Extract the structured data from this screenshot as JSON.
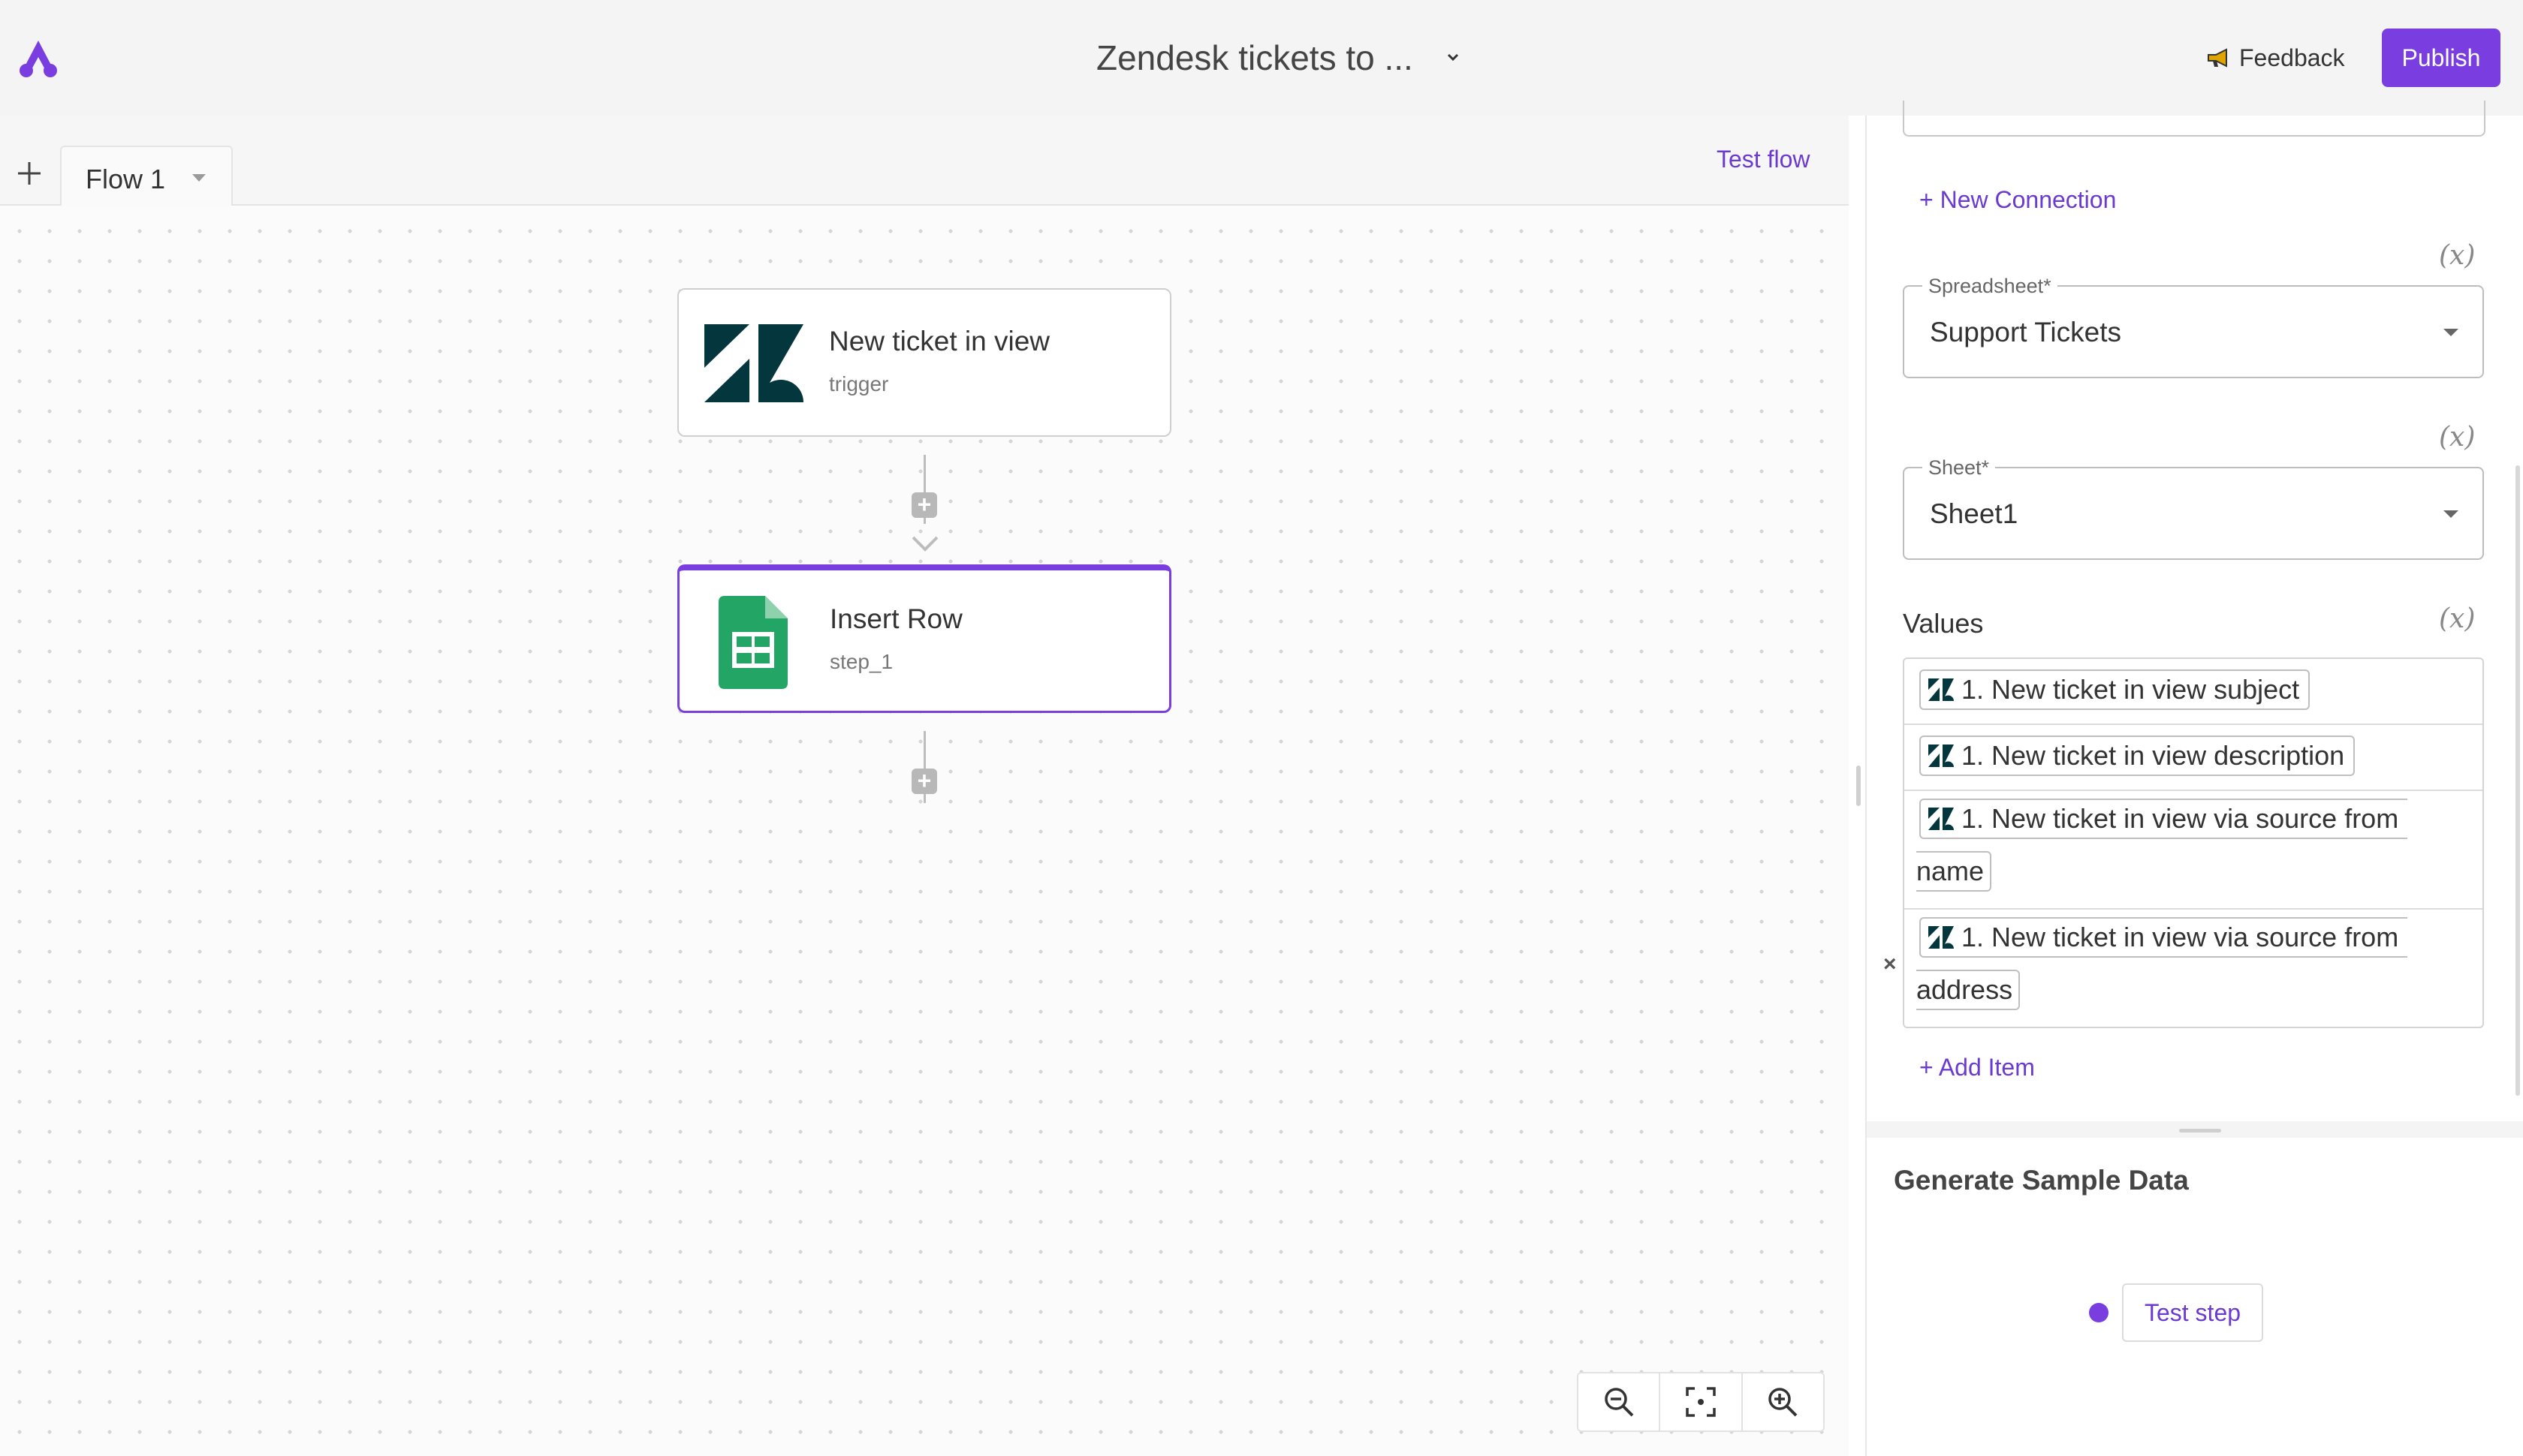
{
  "header": {
    "title": "Zendesk tickets to ...",
    "feedback_label": "Feedback",
    "publish_label": "Publish"
  },
  "canvas": {
    "tab_label": "Flow 1",
    "test_flow_label": "Test flow",
    "nodes": [
      {
        "title": "New ticket in view",
        "subtitle": "trigger",
        "icon": "zendesk-icon"
      },
      {
        "title": "Insert Row",
        "subtitle": "step_1",
        "icon": "google-sheets-icon"
      }
    ],
    "zoom_controls": [
      "zoom-out-icon",
      "fit-view-icon",
      "zoom-in-icon"
    ]
  },
  "panel": {
    "new_connection_label": "+ New Connection",
    "spreadsheet": {
      "label": "Spreadsheet*",
      "value": "Support Tickets"
    },
    "sheet": {
      "label": "Sheet*",
      "value": "Sheet1"
    },
    "values_label": "Values",
    "values": [
      {
        "chip": "1. New ticket in view subject",
        "cont": ""
      },
      {
        "chip": "1. New ticket in view description",
        "cont": ""
      },
      {
        "chip": "1. New ticket in view via source from",
        "cont": "name"
      },
      {
        "chip": "1. New ticket in view via source from",
        "cont": "address"
      }
    ],
    "add_item_label": "+ Add Item",
    "sample_title": "Generate Sample Data",
    "test_step_label": "Test step"
  },
  "colors": {
    "accent": "#7a3ee0",
    "link": "#6a3ad1",
    "zendesk": "#03363d",
    "sheets": "#23a566"
  }
}
